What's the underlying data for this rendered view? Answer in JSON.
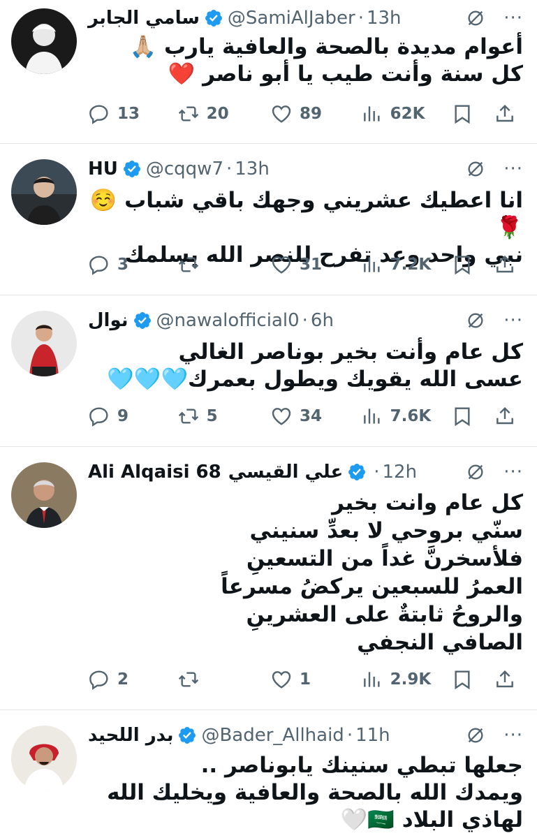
{
  "colors": {
    "verified_blue": "#1d9bf0",
    "secondary_text": "#536471",
    "divider": "#e6e6e6"
  },
  "icons": {
    "verified": "verified-badge-icon",
    "grok": "grok-icon",
    "more": "more-icon",
    "reply": "reply-icon",
    "retweet": "retweet-icon",
    "like": "like-icon",
    "views": "views-icon",
    "bookmark": "bookmark-icon",
    "share": "share-icon"
  },
  "more_label": "···",
  "tweets": [
    {
      "name": "سامي الجابر",
      "handle": "@SamiAlJaber",
      "time": "13h",
      "text": "أعوام مديدة بالصحة والعافية يارب 🙏🏼\nكل سنة وأنت طيب يا أبو ناصر ❤️",
      "replies": "13",
      "retweets": "20",
      "likes": "89",
      "views": "62K"
    },
    {
      "name": "HU",
      "handle": "@cqqw7",
      "time": "13h",
      "text": "انا اعطيك عشريني وجهك باقي شباب ☺️🌹\nنبي واحد وعد تفرح للنصر الله يسلمك",
      "replies": "3",
      "retweets": "",
      "likes": "31",
      "views": "7.2K"
    },
    {
      "name": "نوال",
      "handle": "@nawalofficial0",
      "time": "6h",
      "text": "كل عام وأنت بخير بوناصر الغالي\nعسى الله يقويك ويطول بعمرك🩵🩵🩵",
      "replies": "9",
      "retweets": "5",
      "likes": "34",
      "views": "7.6K"
    },
    {
      "name": "علي القيسي",
      "handle": "Ali Alqaisi 68",
      "time": "12h",
      "text": "كل عام وانت بخير\nسنّي بروحي لا بعدِّ سنيني\nفلأسخرنَّ غداً من التسعينِ\nالعمرُ للسبعين يركضُ مسرعاً\nوالروحُ ثابتةٌ على العشرينِ\nالصافي النجفي",
      "replies": "2",
      "retweets": "",
      "likes": "1",
      "views": "2.9K"
    },
    {
      "name": "بدر اللحيد",
      "handle": "@Bader_Allhaid",
      "time": "11h",
      "text": "جعلها تبطي سنينك يابوناصر ..\nويمدك الله بالصحة والعافية ويخليك الله\nلهاذي البلاد 🇸🇦🤍",
      "replies": "",
      "retweets": "",
      "likes": "",
      "views": ""
    }
  ]
}
